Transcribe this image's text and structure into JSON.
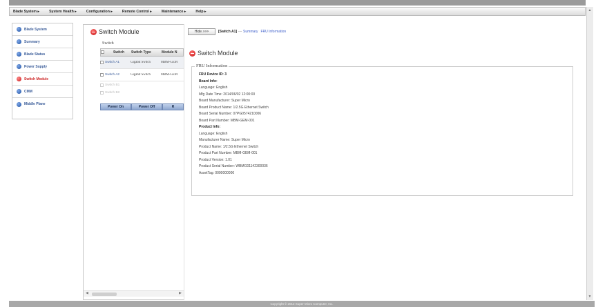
{
  "menu": [
    "Blade System ▸",
    "System Health ▸",
    "Configuration ▸",
    "Remote Control ▸",
    "Maintenance ▸",
    "Help ▸"
  ],
  "sidebar": {
    "items": [
      {
        "label": "Blade System",
        "icon": "blue-globe-icon"
      },
      {
        "label": "Summary",
        "icon": "blue-globe-icon"
      },
      {
        "label": "Blade Status",
        "icon": "blue-globe-icon"
      },
      {
        "label": "Power Supply",
        "icon": "blue-globe-icon"
      },
      {
        "label": "Switch Module",
        "icon": "red-globe-icon",
        "active": true
      },
      {
        "label": "CMM",
        "icon": "blue-globe-icon"
      },
      {
        "label": "Middle Plane",
        "icon": "blue-globe-icon"
      }
    ]
  },
  "mid": {
    "title": "Switch Module",
    "legend": "Switch",
    "headers": [
      "Switch",
      "Switch Type",
      "Module N"
    ],
    "rows": [
      {
        "name": "Switch A1",
        "type": "Gigabit Switch",
        "model": "MBM-GEM"
      },
      {
        "name": "Switch A2",
        "type": "Gigabit Switch",
        "model": "MBM-GEM"
      },
      {
        "name": "Switch B1",
        "type": "",
        "model": ""
      },
      {
        "name": "Switch B2",
        "type": "",
        "model": ""
      }
    ],
    "buttons": [
      "Power On",
      "Power Off",
      "R"
    ]
  },
  "right": {
    "hide_label": "Hide >>>",
    "crumb_current": "[Switch A1]",
    "crumb_sep": "---",
    "crumb_links": [
      "Summary",
      "FRU Information"
    ],
    "title": "Switch Module",
    "fru_legend": "FRU Information",
    "fru_lines": [
      {
        "text": "FRU Device ID: 3",
        "bold": true
      },
      {
        "text": "Board Info:",
        "bold": true
      },
      {
        "text": "Language: English",
        "bold": false
      },
      {
        "text": "Mfg Date Time: 2014/06/02 12:00:00",
        "bold": false
      },
      {
        "text": "Board Manufacturer: Super Micro",
        "bold": false
      },
      {
        "text": "Board Product Name: 1/2.5G Ethernet Switch",
        "bold": false
      },
      {
        "text": "Board Serial Number: 07PG0574210006",
        "bold": false
      },
      {
        "text": "Board Part Number: MBM-GEM-001",
        "bold": false
      },
      {
        "text": "Product Info:",
        "bold": true
      },
      {
        "text": "Language: English",
        "bold": false
      },
      {
        "text": "Manufacturer Name: Super Micro",
        "bold": false
      },
      {
        "text": "Product Name: 1/2.5G Ethernet Switch",
        "bold": false
      },
      {
        "text": "Product Part Number: MBM-GEM-001",
        "bold": false
      },
      {
        "text": "Product Version: 1.01",
        "bold": false
      },
      {
        "text": "Product Serial Number: WBMG01142300036",
        "bold": false
      },
      {
        "text": "AssetTag: 0000000000",
        "bold": false
      }
    ]
  },
  "footer": "Copyright © 2012 Super Micro Computer, Inc."
}
